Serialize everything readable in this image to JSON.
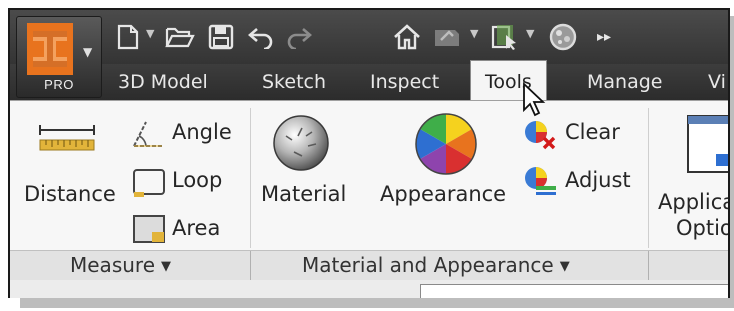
{
  "app": {
    "edition_label": "PRO"
  },
  "quick_access": {
    "icons": [
      "new-document-icon",
      "open-folder-icon",
      "save-icon",
      "undo-icon",
      "redo-icon",
      "home-icon",
      "return-icon",
      "project-icon",
      "appearance-override-icon",
      "more-icon"
    ]
  },
  "ribbon": {
    "tabs": [
      {
        "label": "3D Model",
        "active": false
      },
      {
        "label": "Sketch",
        "active": false
      },
      {
        "label": "Inspect",
        "active": false
      },
      {
        "label": "Tools",
        "active": true
      },
      {
        "label": "Manage",
        "active": false
      },
      {
        "label": "Vi",
        "active": false
      }
    ]
  },
  "measure_panel": {
    "title": "Measure",
    "distance_label": "Distance",
    "angle_label": "Angle",
    "loop_label": "Loop",
    "area_label": "Area"
  },
  "material_panel": {
    "title": "Material and Appearance",
    "material_label": "Material",
    "appearance_label": "Appearance",
    "clear_label": "Clear",
    "adjust_label": "Adjust"
  },
  "options_panel": {
    "app_options_line1": "Applica",
    "app_options_line2": "Optio"
  },
  "colors": {
    "accent_orange": "#e8731e",
    "ribbon_dark": "#333333",
    "panel_bg": "#f7f7f7"
  }
}
